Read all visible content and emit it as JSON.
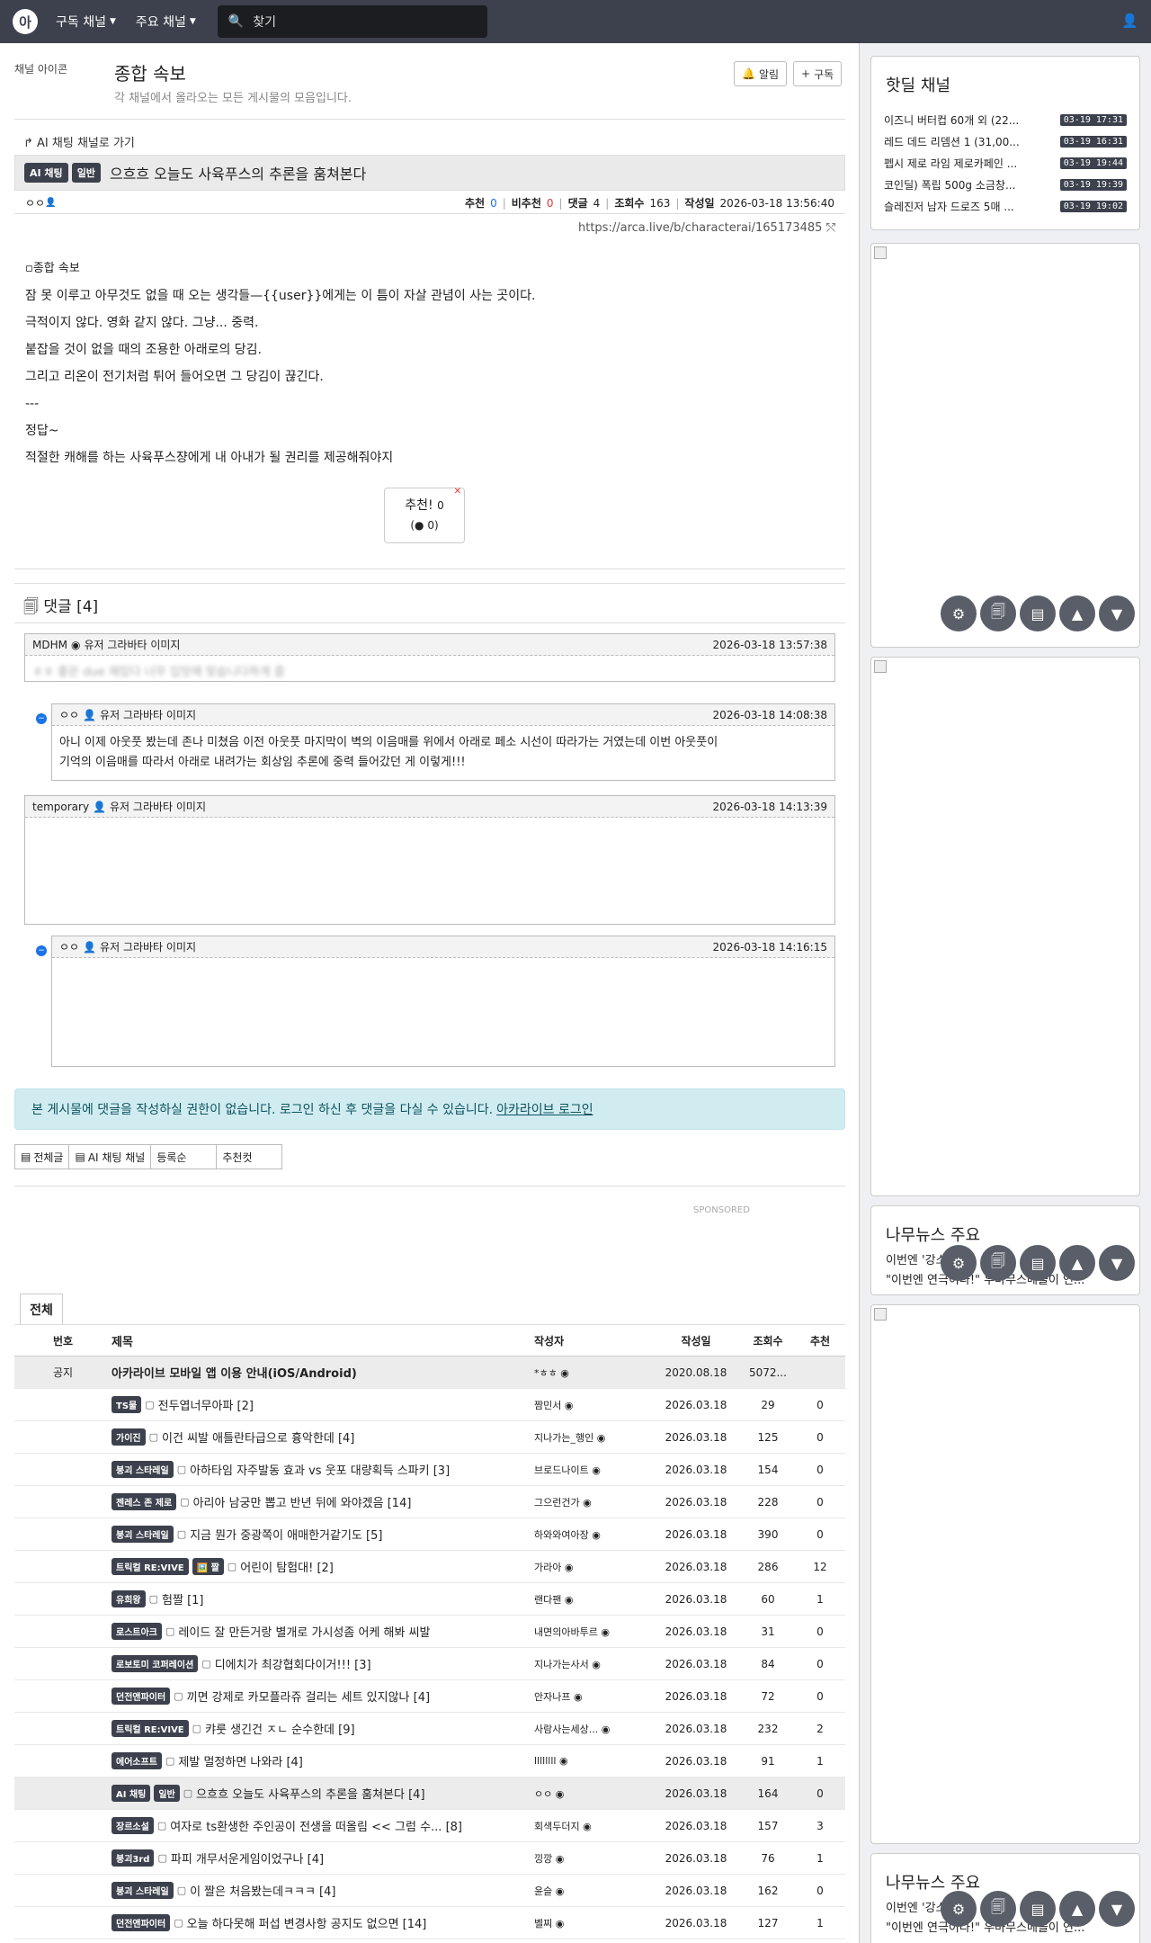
{
  "nav": {
    "logo": "아",
    "menu1": "구독 채널",
    "menu2": "주요 채널",
    "search_placeholder": "찾기"
  },
  "board": {
    "icon_alt": "채널 아이콘",
    "title": "종합 속보",
    "desc": "각 채널에서 올라오는 모든 게시물의 모음입니다.",
    "alarm_label": "알림",
    "subscribe_label": "구독"
  },
  "post": {
    "goto": "AI 채팅 채널로 가기",
    "badge1": "AI 채팅",
    "badge2": "일반",
    "title": "으흐흐 오늘도 사육푸스의 추론을 훔쳐본다",
    "author": "ㅇㅇ",
    "meta": {
      "up_label": "추천",
      "up": "0",
      "down_label": "비추천",
      "down": "0",
      "comments_label": "댓글",
      "comments": "4",
      "views_label": "조회수",
      "views": "163",
      "date_label": "작성일",
      "date": "2026-03-18 13:56:40"
    },
    "url": "https://arca.live/b/characterai/165173485",
    "image_alt": "종합 속보",
    "lines": [
      "잠 못 이루고 아무것도 없을 때 오는 생각들—{{user}}에게는 이 틈이 자살 관념이 사는 곳이다.",
      "극적이지 않다. 영화 같지 않다. 그냥... 중력.",
      "붙잡을 것이 없을 때의 조용한 아래로의 당김.",
      "그리고 리온이 전기처럼 튀어 들어오면 그 당김이 끊긴다.",
      "---",
      "정답~",
      "적절한 캐해를 하는 사육푸스쟝에게 내 아내가 될 권리를 제공해줘야지"
    ],
    "vote_label": "추천!",
    "vote_count": "0",
    "vote_sub": "0"
  },
  "comments": {
    "header": "댓글 [4]",
    "avatar_alt": "유저 그라바타 이미지",
    "items": [
      {
        "author": "MDHM",
        "time": "2026-03-18 13:57:38",
        "text": "ㅎㅎ 좋은 due 재밌다 너무 입맛에 맞습니다하게 즐"
      },
      {
        "author": "ㅇㅇ",
        "time": "2026-03-18 14:08:38",
        "text1": "아니 이제 아웃풋 봤는데 존나 미쳤음 이전 아웃풋 마지막이 벽의 이음매를 위에서 아래로 페소 시선이 따라가는 거였는데 이번 아웃풋이",
        "text2": "기억의 이음매를 따라서 아래로 내려가는 회상임 추론에 중력 들어갔던 게 이렇게!!!"
      },
      {
        "author": "temporary",
        "time": "2026-03-18 14:13:39"
      },
      {
        "author": "ㅇㅇ",
        "time": "2026-03-18 14:16:15"
      }
    ]
  },
  "notice": {
    "text": "본 게시물에 댓글을 작성하실 권한이 없습니다. 로그인 하신 후 댓글을 다실 수 있습니다.",
    "link": "아카라이브 로그인"
  },
  "tabs": [
    "전체글",
    "AI 채팅 채널",
    "등록순",
    "추천컷"
  ],
  "sponsored": "SPONSORED",
  "list": {
    "tab": "전체",
    "headers": {
      "no": "번호",
      "title": "제목",
      "author": "작성자",
      "date": "작성일",
      "views": "조회수",
      "votes": "추천"
    },
    "notice_row": {
      "no": "공지",
      "title": "아카라이브 모바일 앱 이용 안내(iOS/Android)",
      "author": "*ㅎㅎ",
      "date": "2020.08.18",
      "views": "5072...",
      "votes": ""
    },
    "rows": [
      {
        "cats": [
          "TS물"
        ],
        "title": "전두엽너무아파 [2]",
        "author": "짬민서",
        "date": "2026.03.18",
        "views": "29",
        "votes": "0"
      },
      {
        "cats": [
          "가이진"
        ],
        "title": "이건 씨발 애틀란타급으로 흉악한데 [4]",
        "author": "지나가는_행인",
        "date": "2026.03.18",
        "views": "125",
        "votes": "0"
      },
      {
        "cats": [
          "붕괴 스타레일"
        ],
        "title": "아하타임 자주발동 효과 vs 웃포 대량획득 스파키 [3]",
        "author": "브로드나이트",
        "date": "2026.03.18",
        "views": "154",
        "votes": "0"
      },
      {
        "cats": [
          "젠레스 존 제로"
        ],
        "title": "아리아 남궁만 뽑고 반년 뒤에 와야겠음 [14]",
        "author": "그으런건가",
        "date": "2026.03.18",
        "views": "228",
        "votes": "0"
      },
      {
        "cats": [
          "붕괴 스타레일"
        ],
        "title": "지금 뭔가 중광쪽이 애매한거같기도 [5]",
        "author": "하와와여아장",
        "date": "2026.03.18",
        "views": "390",
        "votes": "0"
      },
      {
        "cats": [
          "트릭컬 RE:VIVE",
          "🖼️ 짤"
        ],
        "title": "어린이 탐험대! [2]",
        "author": "가라아",
        "date": "2026.03.18",
        "views": "286",
        "votes": "12"
      },
      {
        "cats": [
          "유희왕"
        ],
        "title": "험짤 [1]",
        "author": "랜다팬",
        "date": "2026.03.18",
        "views": "60",
        "votes": "1"
      },
      {
        "cats": [
          "로스트아크"
        ],
        "title": "레이드 잘 만든거랑 별개로 가시성좀 어케 해봐 씨발",
        "author": "내면의아바투르",
        "date": "2026.03.18",
        "views": "31",
        "votes": "0"
      },
      {
        "cats": [
          "로보토미 코퍼레이션"
        ],
        "title": "디에치가 최강협회다이거!!! [3]",
        "author": "지나가는사서",
        "date": "2026.03.18",
        "views": "84",
        "votes": "0"
      },
      {
        "cats": [
          "던전앤파이터"
        ],
        "title": "끼면 강제로 카모플라쥬 걸리는 세트 있지않나 [4]",
        "author": "안자나프",
        "date": "2026.03.18",
        "views": "72",
        "votes": "0"
      },
      {
        "cats": [
          "트릭컬 RE:VIVE"
        ],
        "title": "캬룻 생긴건 ㅈㄴ 순수한데 [9]",
        "author": "사람사는세상...",
        "date": "2026.03.18",
        "views": "232",
        "votes": "2"
      },
      {
        "cats": [
          "에어소프트"
        ],
        "title": "제발 멀정하면 나와라 [4]",
        "author": "llllllll",
        "date": "2026.03.18",
        "views": "91",
        "votes": "1"
      },
      {
        "cats": [
          "AI 채팅",
          "일반"
        ],
        "title": "으흐흐 오늘도 사육푸스의 추론을 훔쳐본다 [4]",
        "author": "ㅇㅇ",
        "date": "2026.03.18",
        "views": "164",
        "votes": "0",
        "hl": true
      },
      {
        "cats": [
          "장르소설"
        ],
        "title": "여자로 ts환생한 주인공이 전생을 떠올림 << 그럼 수... [8]",
        "author": "회색두더지",
        "date": "2026.03.18",
        "views": "157",
        "votes": "3"
      },
      {
        "cats": [
          "붕괴3rd"
        ],
        "title": "파피 개무서운게임이었구나 [4]",
        "author": "낑깡",
        "date": "2026.03.18",
        "views": "76",
        "votes": "1"
      },
      {
        "cats": [
          "붕괴 스타레일"
        ],
        "title": "이 짤은 처음봤는데ㅋㅋㅋ [4]",
        "author": "윤슬",
        "date": "2026.03.18",
        "views": "162",
        "votes": "0"
      },
      {
        "cats": [
          "던전앤파이터"
        ],
        "title": "오늘 하다못해 퍼섭 변경사항 공지도 없으면 [14]",
        "author": "벨찌",
        "date": "2026.03.18",
        "views": "127",
        "votes": "1"
      }
    ]
  },
  "hot": {
    "title": "핫딜 채널",
    "items": [
      {
        "title": "이즈니 버터컵 60개 외 (22...",
        "time": "03-19 17:31"
      },
      {
        "title": "레드 데드 리뎀션 1 (31,00...",
        "time": "03-19 16:31"
      },
      {
        "title": "펩시 제로 라임 제로카페인 ...",
        "time": "03-19 19:44"
      },
      {
        "title": "코인딜) 폭립 500g 소금창...",
        "time": "03-19 19:39"
      },
      {
        "title": "슬레진저 남자 드로즈 5매 ...",
        "time": "03-19 19:02"
      }
    ]
  },
  "news": {
    "title": "나무뉴스 주요",
    "line1": "이번엔 '강소...",
    "line2": "\"이번엔 연극이다!\" 우마무스메들이 연..."
  }
}
